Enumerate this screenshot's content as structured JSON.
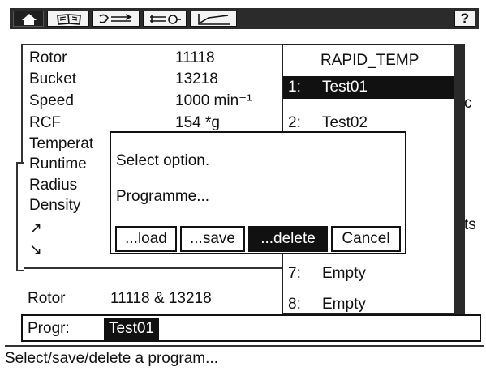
{
  "toolbar": {
    "help_label": "?",
    "tabs": [
      {
        "icon": "home-icon",
        "active": true
      },
      {
        "icon": "book-icon",
        "active": false
      },
      {
        "icon": "rotor-icon",
        "active": false
      },
      {
        "icon": "settings-icon",
        "active": false
      },
      {
        "icon": "graph-icon",
        "active": false
      }
    ]
  },
  "params": [
    {
      "label": "Rotor",
      "value": "11118"
    },
    {
      "label": "Bucket",
      "value": "13218"
    },
    {
      "label": "Speed",
      "value": "1000 min⁻¹"
    },
    {
      "label": "RCF",
      "value": "154 *g"
    },
    {
      "label": "Temperat",
      "value": ""
    },
    {
      "label": "Runtime",
      "value": ""
    },
    {
      "label": "Radius",
      "value": ""
    },
    {
      "label": "Density",
      "value": ""
    }
  ],
  "arrows": {
    "up": "↗",
    "down": "↘"
  },
  "side_fragments": {
    "right_c": "c",
    "right_s": "ts"
  },
  "program_list": {
    "title": "RAPID_TEMP",
    "items": [
      {
        "num": "1:",
        "name": "Test01",
        "selected": true
      },
      {
        "num": "2:",
        "name": "Test02",
        "selected": false
      },
      {
        "num": "7:",
        "name": "Empty",
        "selected": false
      },
      {
        "num": "8:",
        "name": "Empty",
        "selected": false
      }
    ]
  },
  "dialog": {
    "prompt": "Select option.",
    "subject": "Programme...",
    "buttons": [
      {
        "label": "...load",
        "active": false
      },
      {
        "label": "...save",
        "active": false
      },
      {
        "label": "...delete",
        "active": true
      },
      {
        "label": "Cancel",
        "active": false
      }
    ]
  },
  "rotor_line": {
    "label": "Rotor",
    "value": "11118 & 13218"
  },
  "program_field": {
    "label": "Progr:",
    "value": "Test01"
  },
  "status_bar": "Select/save/delete a program...",
  "colors": {
    "background": "#ffffff",
    "ink": "#111111",
    "selection": "#111111",
    "bar": "#2b2b2b"
  }
}
